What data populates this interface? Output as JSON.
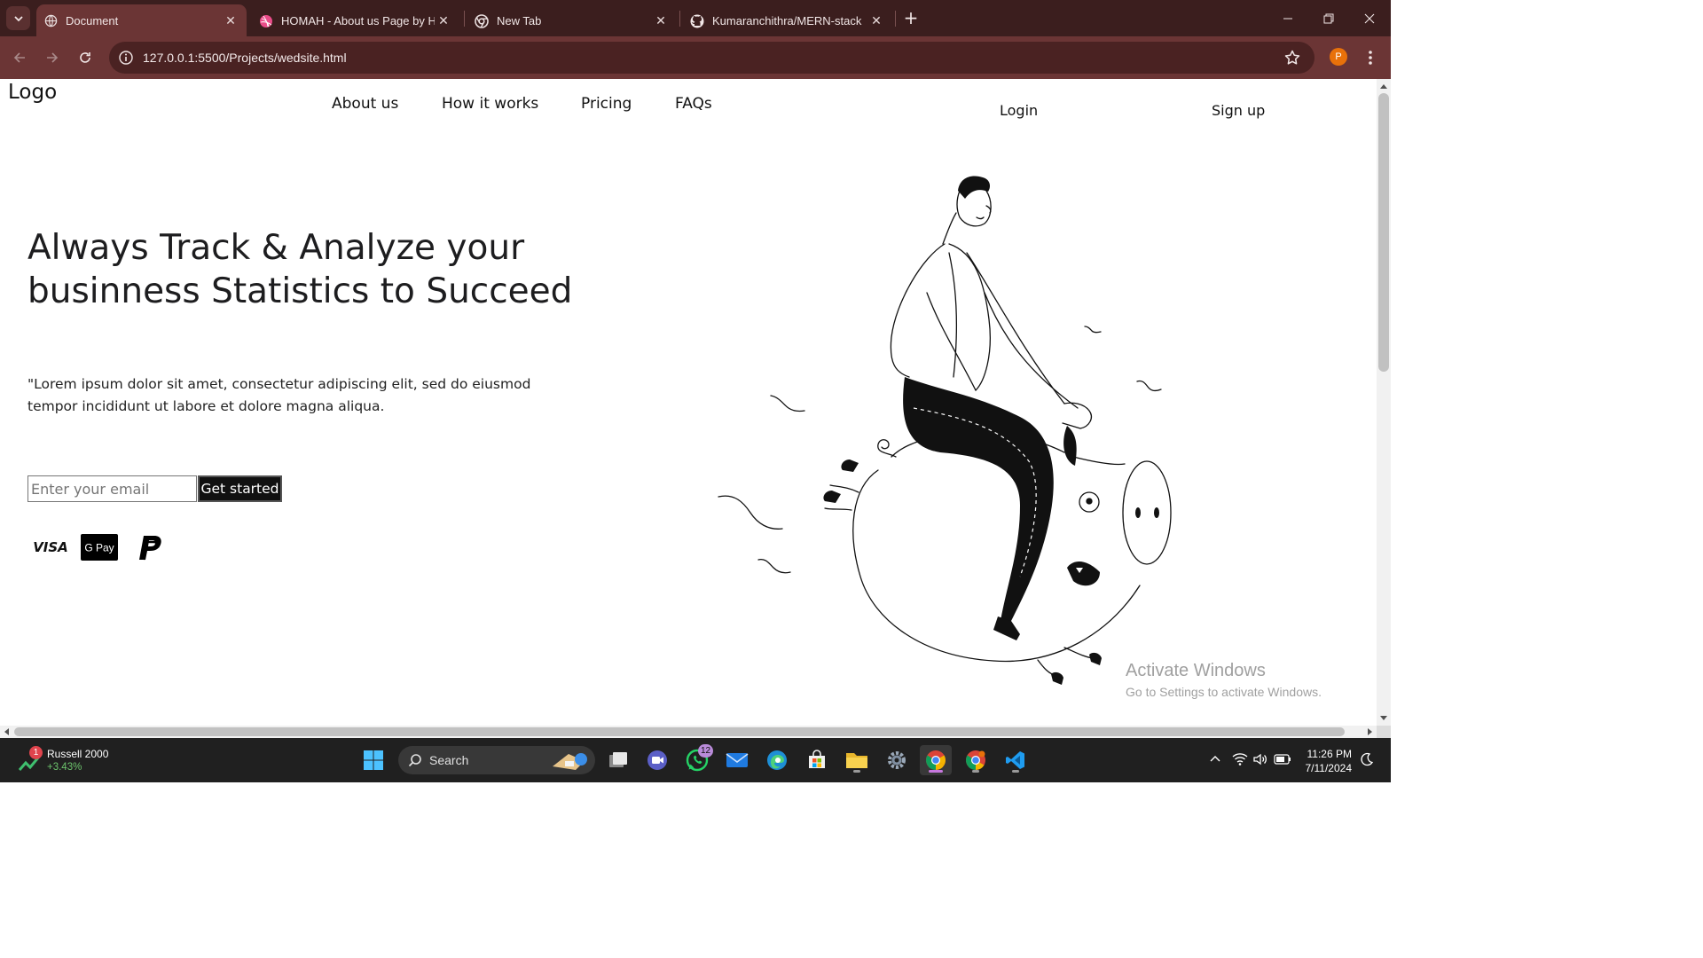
{
  "browser": {
    "tabs": [
      {
        "title": "Document",
        "icon": "globe-icon",
        "active": true
      },
      {
        "title": "HOMAH - About us Page by Ha",
        "icon": "dribbble-icon",
        "active": false
      },
      {
        "title": "New Tab",
        "icon": "chrome-icon",
        "active": false
      },
      {
        "title": "Kumaranchithra/MERN-stack",
        "icon": "github-icon",
        "active": false
      }
    ],
    "close_glyph": "✕",
    "new_tab_glyph": "+",
    "window_controls": {
      "minimize": "—",
      "restore": "❐",
      "close": "✕"
    },
    "url": "127.0.0.1:5500/Projects/wedsite.html",
    "profile_initial": "P"
  },
  "page": {
    "logo": "Logo",
    "nav": [
      "About us",
      "How it works",
      "Pricing",
      "FAQs"
    ],
    "login": "Login",
    "signup": "Sign up",
    "headline": "Always Track & Analyze your businness Statistics to Succeed",
    "lead": "\"Lorem ipsum dolor sit amet, consectetur adipiscing elit, sed do eiusmod tempor incididunt ut labore et dolore magna aliqua.",
    "email_placeholder": "Enter your email",
    "cta": "Get started",
    "payment_methods": [
      {
        "name": "VISA",
        "icon": "visa-icon"
      },
      {
        "name": "G Pay",
        "icon": "gpay-icon"
      },
      {
        "name": "PayPal",
        "icon": "paypal-icon"
      }
    ]
  },
  "watermark": {
    "title": "Activate Windows",
    "subtitle": "Go to Settings to activate Windows."
  },
  "taskbar": {
    "widget": {
      "name": "Russell 2000",
      "change": "+3.43%",
      "badge": "1"
    },
    "search_label": "Search",
    "teams_badge": "12",
    "time": "11:26 PM",
    "date": "7/11/2024"
  },
  "colors": {
    "tabstrip": "#3b1e1e",
    "toolbar": "#6b3535",
    "omnibox": "#4a2222",
    "taskbar": "#202020"
  }
}
